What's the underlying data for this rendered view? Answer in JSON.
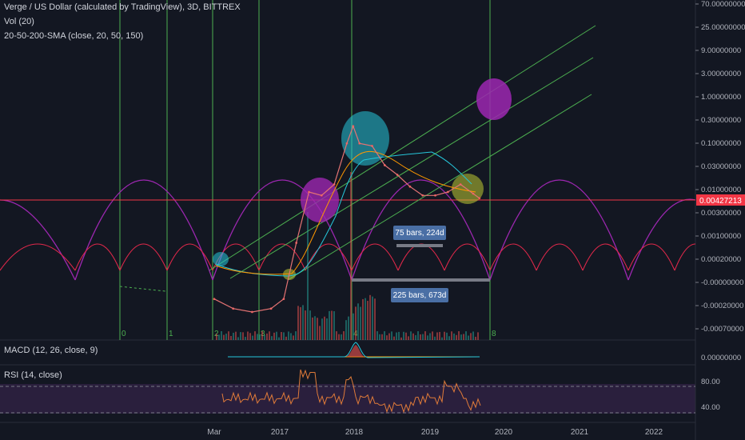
{
  "header": {
    "title": "Verge / US Dollar (calculated by TradingView), 3D, BITTREX",
    "vol": "Vol (20)",
    "sma": "20-50-200-SMA (close, 20, 50, 150)"
  },
  "macd_label": "MACD (12, 26, close, 9)",
  "rsi_label": "RSI (14, close)",
  "colors": {
    "background": "#131722",
    "cycle_line": "#4caf50",
    "arc_large": "#9c27b0",
    "arc_small": "#e0284a",
    "price_tag": "#f23645",
    "label_box": "#4a6fa5",
    "rsi_band": "#2a1f3d"
  },
  "chart_data": {
    "type": "line",
    "title": "Verge / US Dollar (calculated by TradingView), 3D, BITTREX",
    "y_scale": "log",
    "price_axis_ticks": [
      "70.00000000",
      "25.00000000",
      "9.00000000",
      "3.00000000",
      "1.00000000",
      "0.30000000",
      "0.10000000",
      "0.03000000",
      "0.01000000",
      "0.00300000",
      "0.00100000",
      "0.00020000",
      "-0.00000000",
      "-0.00020000",
      "-0.00070000"
    ],
    "current_price": "0.00427213",
    "macd_ticks": [
      "0.00000000"
    ],
    "rsi_ticks": [
      "80.00",
      "40.00"
    ],
    "x_ticks": [
      "Mar",
      "2017",
      "2018",
      "2019",
      "2020",
      "2021",
      "2022"
    ],
    "cycle_markers": [
      "0",
      "1",
      "2",
      "3",
      "4",
      "8"
    ],
    "measurements": [
      {
        "label": "75 bars, 224d"
      },
      {
        "label": "225 bars, 673d"
      }
    ],
    "price_series": [
      {
        "date": "2016-03",
        "close": 2e-05
      },
      {
        "date": "2016-06",
        "close": 1.2e-05
      },
      {
        "date": "2016-09",
        "close": 1e-05
      },
      {
        "date": "2016-12",
        "close": 1.2e-05
      },
      {
        "date": "2017-02",
        "close": 2e-05
      },
      {
        "date": "2017-04",
        "close": 0.0004
      },
      {
        "date": "2017-06",
        "close": 0.006
      },
      {
        "date": "2017-08",
        "close": 0.005
      },
      {
        "date": "2017-10",
        "close": 0.009
      },
      {
        "date": "2017-12",
        "close": 0.08
      },
      {
        "date": "2018-01",
        "close": 0.2
      },
      {
        "date": "2018-02",
        "close": 0.08
      },
      {
        "date": "2018-04",
        "close": 0.07
      },
      {
        "date": "2018-06",
        "close": 0.025
      },
      {
        "date": "2018-08",
        "close": 0.015
      },
      {
        "date": "2018-10",
        "close": 0.008
      },
      {
        "date": "2018-12",
        "close": 0.005
      },
      {
        "date": "2019-02",
        "close": 0.005
      },
      {
        "date": "2019-04",
        "close": 0.006
      },
      {
        "date": "2019-06",
        "close": 0.009
      },
      {
        "date": "2019-08",
        "close": 0.0055
      },
      {
        "date": "2019-09",
        "close": 0.0043
      }
    ],
    "grid": false
  }
}
